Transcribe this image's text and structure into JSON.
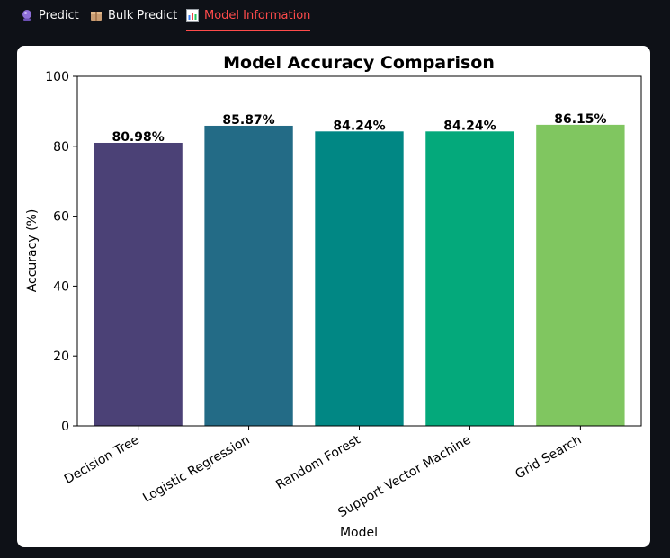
{
  "tabs": [
    {
      "label": "Predict",
      "icon": "crystal-ball-icon",
      "active": false
    },
    {
      "label": "Bulk Predict",
      "icon": "package-icon",
      "active": false
    },
    {
      "label": "Model Information",
      "icon": "bar-chart-icon",
      "active": true
    }
  ],
  "colors": {
    "accent": "#ff4b4b",
    "background": "#0e1117",
    "card": "#ffffff"
  },
  "chart_data": {
    "type": "bar",
    "title": "Model Accuracy Comparison",
    "xlabel": "Model",
    "ylabel": "Accuracy (%)",
    "ylim": [
      0,
      100
    ],
    "yticks": [
      0,
      20,
      40,
      60,
      80,
      100
    ],
    "grid": false,
    "categories": [
      "Decision Tree",
      "Logistic Regression",
      "Random Forest",
      "Support Vector Machine",
      "Grid Search"
    ],
    "values": [
      80.98,
      85.87,
      84.24,
      84.24,
      86.15
    ],
    "value_labels": [
      "80.98%",
      "85.87%",
      "84.24%",
      "84.24%",
      "86.15%"
    ],
    "bar_colors": [
      "#4b4176",
      "#236b86",
      "#018784",
      "#04a97b",
      "#80c660"
    ]
  }
}
